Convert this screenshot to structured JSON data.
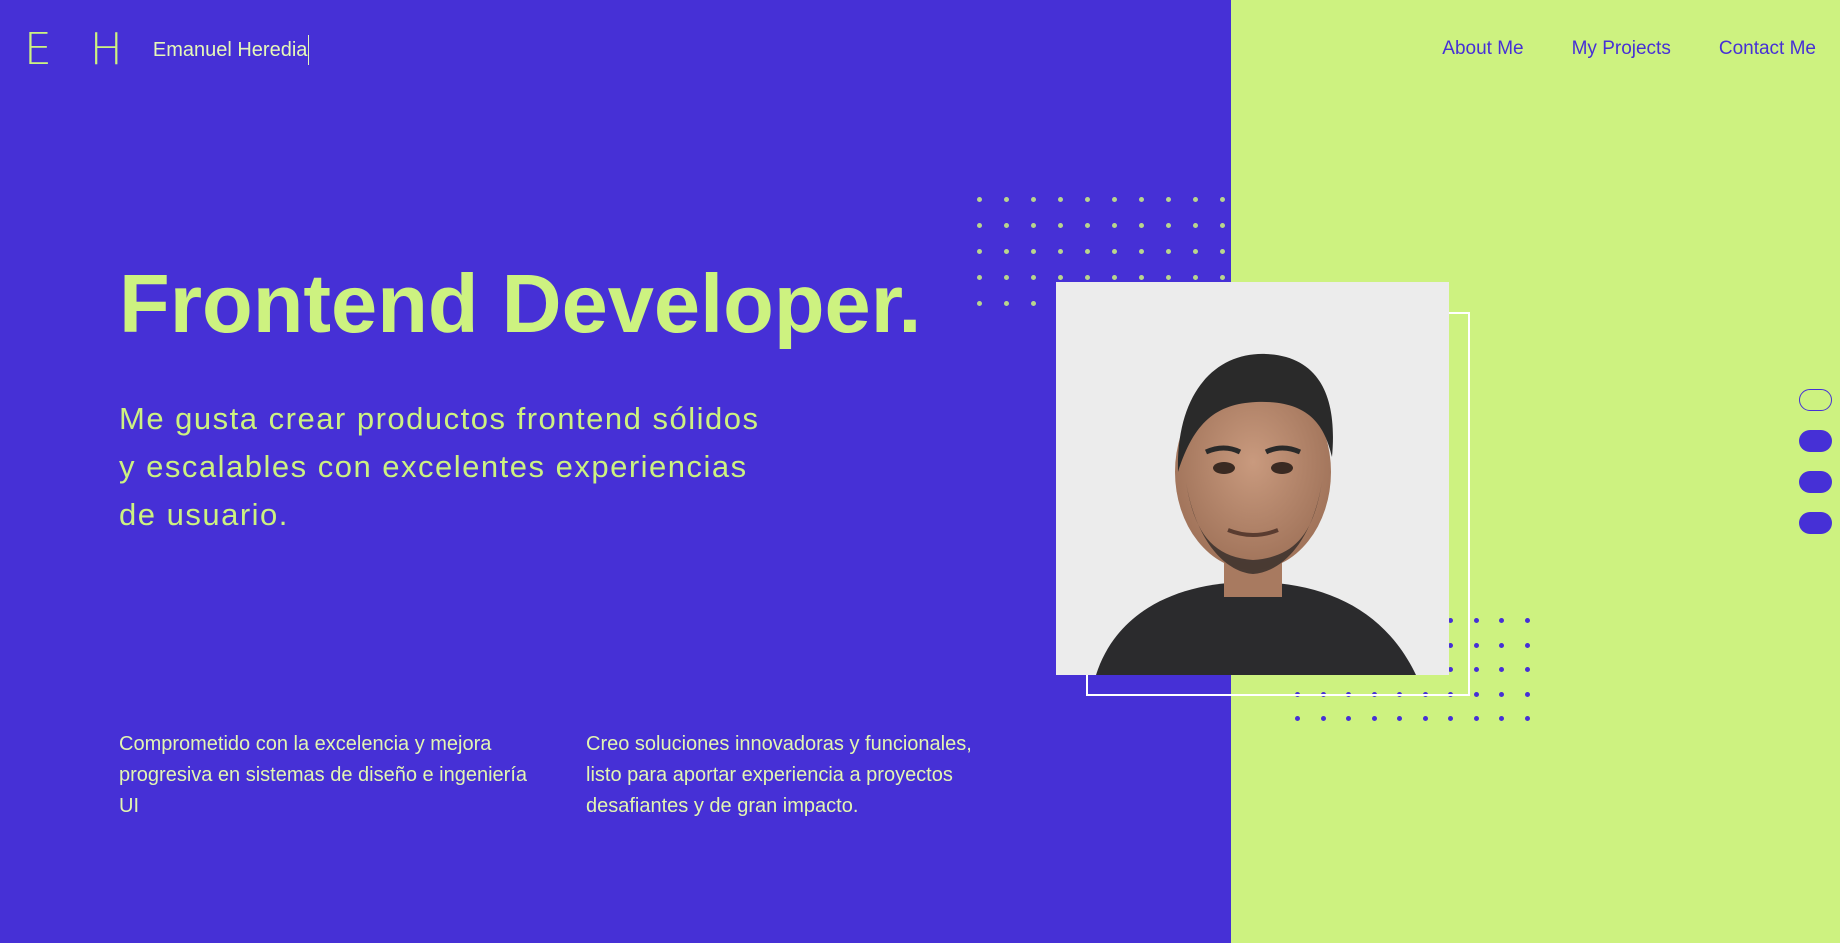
{
  "brand": {
    "initials": "E H",
    "name": "Emanuel Heredia"
  },
  "nav": {
    "items": [
      {
        "label": "About Me"
      },
      {
        "label": "My Projects"
      },
      {
        "label": "Contact Me"
      }
    ]
  },
  "hero": {
    "title": "Frontend Developer.",
    "subtitle": "Me gusta crear productos frontend sólidos y escalables con excelentes experiencias de usuario."
  },
  "features": [
    {
      "text": "Comprometido con la excelencia y mejora progresiva en sistemas de diseño e ingeniería UI"
    },
    {
      "text": "Creo soluciones innovadoras y funcionales, listo para aportar experiencia a proyectos desafiantes y de gran impacto."
    }
  ],
  "indicators": {
    "count": 4,
    "active_index": 0
  },
  "colors": {
    "primary": "#4630d6",
    "accent": "#cdf280",
    "outline": "#ffffff"
  },
  "icons": {
    "portrait": "profile-photo",
    "pattern": "dot-grid"
  }
}
